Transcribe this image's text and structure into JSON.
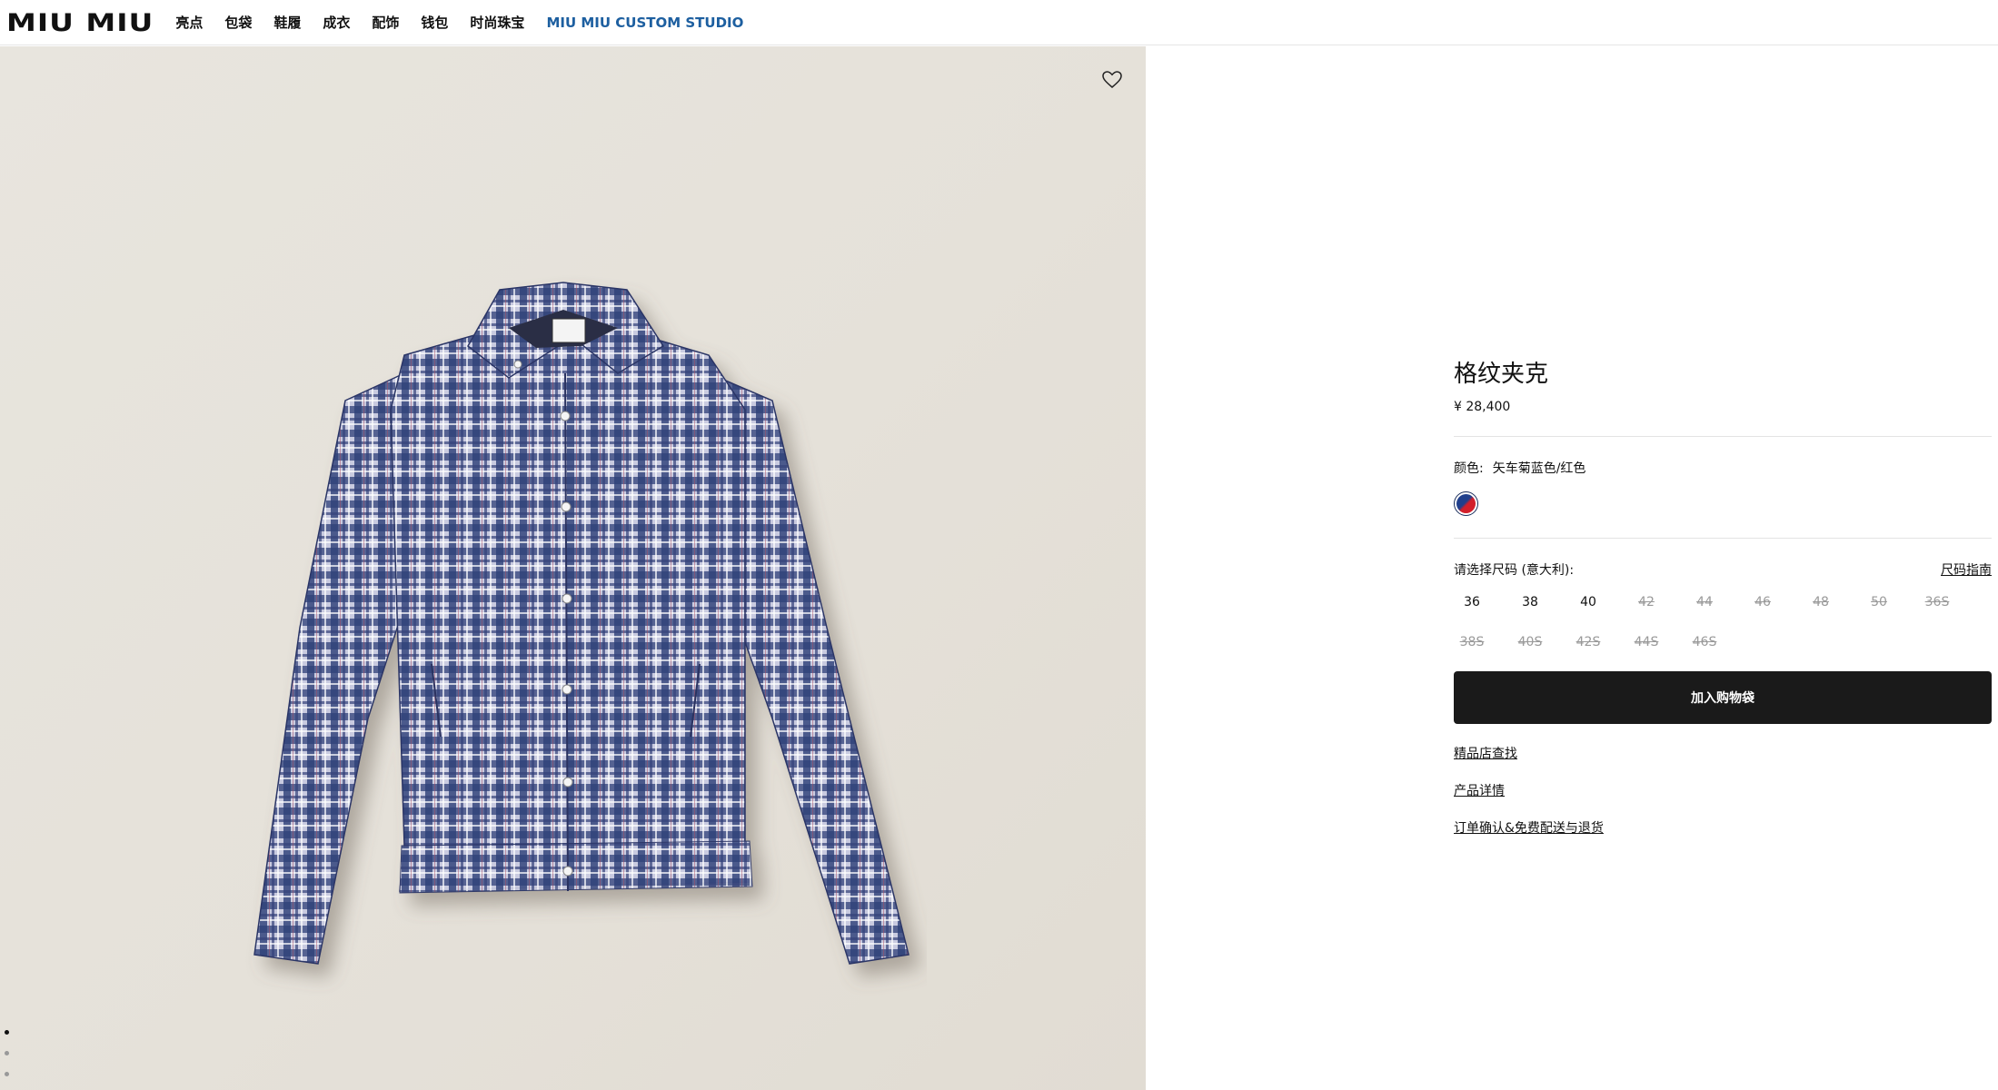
{
  "header": {
    "logo": "MIU MIU",
    "nav": [
      "亮点",
      "包袋",
      "鞋履",
      "成衣",
      "配饰",
      "钱包",
      "时尚珠宝"
    ],
    "custom_studio": "MIU MIU CUSTOM STUDIO"
  },
  "gallery": {
    "image_description": "plaid-jacket-photo",
    "pager_total": 3,
    "pager_active": 1
  },
  "product": {
    "title": "格纹夹克",
    "price": "¥ 28,400",
    "color_label": "颜色:",
    "color_value": "矢车菊蓝色/红色",
    "size_label": "请选择尺码 (意大利):",
    "size_guide": "尺码指南",
    "sizes": [
      {
        "label": "36",
        "available": true
      },
      {
        "label": "38",
        "available": true
      },
      {
        "label": "40",
        "available": true
      },
      {
        "label": "42",
        "available": false
      },
      {
        "label": "44",
        "available": false
      },
      {
        "label": "46",
        "available": false
      },
      {
        "label": "48",
        "available": false
      },
      {
        "label": "50",
        "available": false
      },
      {
        "label": "36S",
        "available": false
      },
      {
        "label": "38S",
        "available": false
      },
      {
        "label": "40S",
        "available": false
      },
      {
        "label": "42S",
        "available": false
      },
      {
        "label": "44S",
        "available": false
      },
      {
        "label": "46S",
        "available": false
      }
    ],
    "add_to_bag": "加入购物袋",
    "links": [
      "精品店查找",
      "产品详情",
      "订单确认&免费配送与退货"
    ]
  },
  "colors": {
    "accent": "#1d5fa0",
    "button": "#1a1a1a",
    "swatch_blue": "#1f3f8c",
    "swatch_red": "#d21f2a"
  }
}
